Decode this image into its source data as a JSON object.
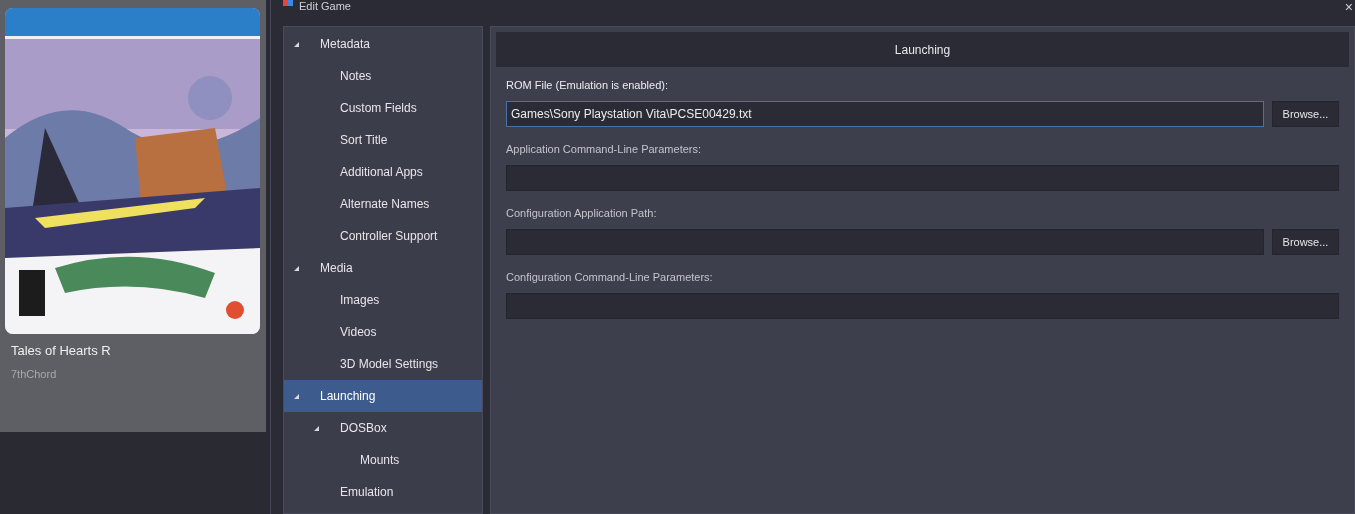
{
  "library_card": {
    "title": "Tales of Hearts R",
    "subtitle": "7thChord"
  },
  "window": {
    "title": "Edit Game",
    "close": "×"
  },
  "tree": [
    {
      "label": "Metadata",
      "expanded": true,
      "selected": false,
      "children": [
        {
          "label": "Notes",
          "selected": false
        },
        {
          "label": "Custom Fields",
          "selected": false
        },
        {
          "label": "Sort Title",
          "selected": false
        },
        {
          "label": "Additional Apps",
          "selected": false
        },
        {
          "label": "Alternate Names",
          "selected": false
        },
        {
          "label": "Controller Support",
          "selected": false
        }
      ]
    },
    {
      "label": "Media",
      "expanded": true,
      "selected": false,
      "children": [
        {
          "label": "Images",
          "selected": false
        },
        {
          "label": "Videos",
          "selected": false
        },
        {
          "label": "3D Model Settings",
          "selected": false
        }
      ]
    },
    {
      "label": "Launching",
      "expanded": true,
      "selected": true,
      "children": [
        {
          "label": "DOSBox",
          "expanded": true,
          "selected": false,
          "children": [
            {
              "label": "Mounts",
              "selected": false
            }
          ]
        },
        {
          "label": "Emulation",
          "selected": false
        }
      ]
    }
  ],
  "panel": {
    "header": "Launching",
    "fields": [
      {
        "label": "ROM File (Emulation is enabled):",
        "value": "Games\\Sony Playstation Vita\\PCSE00429.txt",
        "focused": true,
        "button": "Browse..."
      },
      {
        "label": "Application Command-Line Parameters:",
        "focused": false
      },
      {
        "label": "Configuration Application Path:",
        "focused": false,
        "button": "Browse..."
      },
      {
        "label": "Configuration Command-Line Parameters:",
        "focused": false
      }
    ]
  }
}
